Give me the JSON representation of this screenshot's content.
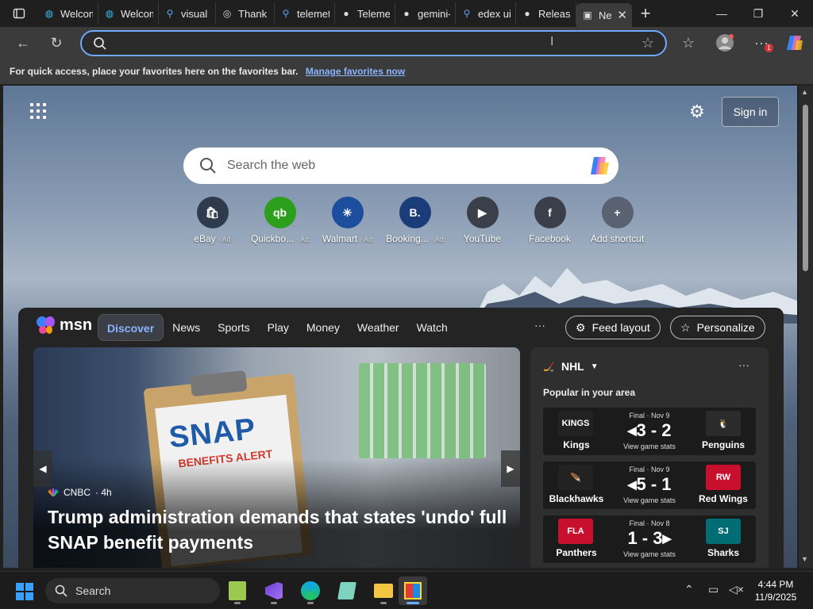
{
  "tabs": [
    {
      "label": "Welcom",
      "favicon": "edge-icon"
    },
    {
      "label": "Welcom",
      "favicon": "edge-icon"
    },
    {
      "label": "visual st",
      "favicon": "search-icon"
    },
    {
      "label": "Thank Y",
      "favicon": "globe-icon"
    },
    {
      "label": "telemet",
      "favicon": "search-icon"
    },
    {
      "label": "Telemet",
      "favicon": "github-icon"
    },
    {
      "label": "gemini-",
      "favicon": "github-icon"
    },
    {
      "label": "edex ui",
      "favicon": "search-icon"
    },
    {
      "label": "Release",
      "favicon": "github-icon"
    },
    {
      "label": "Ne",
      "favicon": "newtab-icon",
      "active": true
    }
  ],
  "address_bar": {
    "value": "",
    "placeholder": ""
  },
  "favorites_bar": {
    "text": "For quick access, place your favorites here on the favorites bar.",
    "link": "Manage favorites now"
  },
  "newtab": {
    "signin_label": "Sign in",
    "search_placeholder": "Search the web",
    "shortcuts": [
      {
        "label": "eBay",
        "ad": "Ad",
        "icon": "ebay-icon",
        "color": "#2f3b4d",
        "glyph": "🛍"
      },
      {
        "label": "Quickbo...",
        "ad": "Ad",
        "icon": "quickbooks-icon",
        "color": "#2ca01c",
        "glyph": "qb"
      },
      {
        "label": "Walmart",
        "ad": "Ad",
        "icon": "walmart-icon",
        "color": "#1d4e9e",
        "glyph": "✳"
      },
      {
        "label": "Booking...",
        "ad": "Ad",
        "icon": "booking-icon",
        "color": "#1a3d7a",
        "glyph": "B."
      },
      {
        "label": "YouTube",
        "ad": "",
        "icon": "youtube-icon",
        "color": "#3a3f4a",
        "glyph": "▶"
      },
      {
        "label": "Facebook",
        "ad": "",
        "icon": "facebook-icon",
        "color": "#3a3f4a",
        "glyph": "f"
      },
      {
        "label": "Add shortcut",
        "ad": "",
        "icon": "plus-icon",
        "color": "#5a6170",
        "glyph": "+"
      }
    ]
  },
  "msn": {
    "logo_text": "msn",
    "nav": [
      "Discover",
      "News",
      "Sports",
      "Play",
      "Money",
      "Weather",
      "Watch"
    ],
    "active_nav": "Discover",
    "more": "···",
    "feed_layout_label": "Feed layout",
    "personalize_label": "Personalize",
    "hero": {
      "image_text": "SNAP",
      "image_subtext": "BENEFITS ALERT",
      "source": "CNBC",
      "age": "4h",
      "title": "Trump administration demands that states 'undo' full SNAP benefit payments"
    },
    "nhl": {
      "title": "NHL",
      "subtitle": "Popular in your area",
      "games": [
        {
          "status": "Final · Nov 9",
          "score": "◂3 - 2",
          "stats": "View game stats",
          "home": "Kings",
          "away": "Penguins",
          "home_color": "#222222",
          "away_color": "#2b2b2b",
          "home_logo": "KINGS",
          "away_logo": "🐧"
        },
        {
          "status": "Final · Nov 9",
          "score": "◂5 - 1",
          "stats": "View game stats",
          "home": "Blackhawks",
          "away": "Red Wings",
          "home_color": "#222222",
          "away_color": "#c8102e",
          "home_logo": "🪶",
          "away_logo": "RW"
        },
        {
          "status": "Final · Nov 8",
          "score": "1 - 3▸",
          "stats": "View game stats",
          "home": "Panthers",
          "away": "Sharks",
          "home_color": "#c8102e",
          "away_color": "#006d75",
          "home_logo": "FLA",
          "away_logo": "SJ"
        }
      ]
    }
  },
  "taskbar": {
    "search_label": "Search",
    "time": "4:44 PM",
    "date": "11/9/2025"
  }
}
